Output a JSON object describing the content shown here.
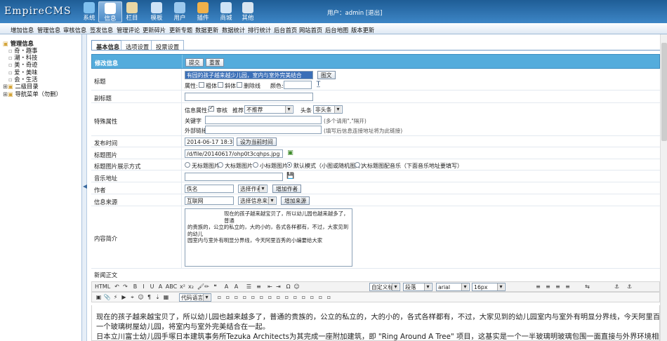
{
  "app": {
    "logo": "EmpireCMS",
    "user_label": "用户：",
    "user_name": "admin",
    "logout": "[退出]"
  },
  "top_nav": [
    {
      "label": "系统",
      "icon": "globe-icon",
      "color": "#7fc0ef"
    },
    {
      "label": "信息",
      "icon": "document-icon",
      "color": "#ffffff"
    },
    {
      "label": "栏目",
      "icon": "folder-icon",
      "color": "#e9d7a4"
    },
    {
      "label": "模板",
      "icon": "template-icon",
      "color": "#cfe3f6"
    },
    {
      "label": "用户",
      "icon": "user-icon",
      "color": "#9cc9ee"
    },
    {
      "label": "插件",
      "icon": "plugin-icon",
      "color": "#f0b14a"
    },
    {
      "label": "商城",
      "icon": "shop-icon",
      "color": "#cfe3f6"
    },
    {
      "label": "其他",
      "icon": "gear-icon",
      "color": "#d9e5f0"
    }
  ],
  "sub_nav": [
    "增加信息",
    "管理信息",
    "审核信息",
    "签发信息",
    "管理评论",
    "更新碎片",
    "更新专题",
    "数据更新",
    "数据统计",
    "排行统计",
    "后台首页",
    "网站首页",
    "后台地图",
    "版本更新"
  ],
  "tree": {
    "root": "管理信息",
    "items": [
      "奇・趣事",
      "潮・科技",
      "美・奇迹",
      "爱・美味",
      "会・生活"
    ],
    "groups": [
      "二级目录",
      "导航菜单（勿删）"
    ]
  },
  "tabs": [
    "基本信息",
    "选项设置",
    "投票设置"
  ],
  "form": {
    "header": "修改信息",
    "submit": "提交",
    "reset": "重置",
    "title_label": "标题",
    "title_value": "有园的孩子越来越少儿园，室内与室外完美结合",
    "title_btn": "图文",
    "attr_label": "属性:",
    "bold": "粗体",
    "italic": "斜体",
    "strike": "删除线",
    "color_label": "颜色:",
    "subtitle_label": "副标题",
    "special_label": "特殊属性",
    "info_attr": "信息属性:",
    "audit": "审核",
    "recommend_label": "推荐",
    "recommend_value": "不推荐",
    "headline_label": "头条",
    "headline_value": "非头条",
    "keywords_label": "关键字",
    "keywords_hint": "(多个请用\",\"隔开)",
    "link_label": "外部链接:",
    "link_hint": "(填写后信息连接地址将为此链接)",
    "time_label": "发布时间",
    "time_value": "2014-06-17 18:31:04",
    "time_btn": "设为当前时间",
    "pic_label": "标题图片",
    "pic_value": "/d/file/20140617/ohp0t3cqhps.jpg",
    "pic_mode_label": "标题图片展示方式",
    "pic_modes": [
      "无标题图片",
      "大标题图片",
      "小标题图片",
      "默认模式（小图或随机图片）",
      "大标题图配音乐（下面音乐地址要填写）"
    ],
    "pic_mode_selected": 3,
    "music_label": "音乐地址",
    "author_label": "作者",
    "author_value": "佚名",
    "author_select": "选择作者",
    "author_btn": "增加作者",
    "source_label": "信息来源",
    "source_value": "互联网",
    "source_select": "选择信息来源",
    "source_btn": "增加来源",
    "intro_label": "内容简介",
    "intro_lines": [
      "现在的孩子越来越宝贝了，所以幼儿园也越来越多了，普通",
      "的贵族的，公立的私立的，大的小的，各式各样都有，不过，大家见到的幼儿",
      "园室内与室外有明显分界线，今天阿里百秀的小编要给大家",
      ""
    ],
    "body_label": "新闻正文"
  },
  "editor": {
    "toolbar1_items": [
      "HTML",
      "↶",
      "↷",
      "B",
      "I",
      "U",
      "A",
      "ABC",
      "x²",
      "x₂",
      "🖌",
      "✏",
      "❝",
      "A",
      "A",
      "☰",
      "≡",
      "⇤",
      "⇥",
      "Ω",
      "☺",
      "自定义标题",
      "段落",
      "arial",
      "16px"
    ],
    "style_value": "自定义标题",
    "para_value": "段落",
    "font_value": "arial",
    "size_value": "16px",
    "code_value": "代码语言",
    "content_lines": [
      "现在的孩子越来越宝贝了，所以幼儿园也越来越多了，普通的贵族的，公立的私立的，大的小的，各式各样都有，不过，大家见到的幼儿园室内与室外有明显分界线，今天阿里百秀的小编要给大家介绍",
      "一个玻璃树屋幼儿园，将室内与室外完美结合在一起。",
      "日本立川富士幼儿园手塚日本建筑事务所Tezuka Architects为其完成一座附加建筑，即 \"Ring Around A Tree\" 项目，这基实是一个一半玻璃明玻璃包围一面直接与外界环境相连的建筑，建筑一半是教"
    ]
  }
}
